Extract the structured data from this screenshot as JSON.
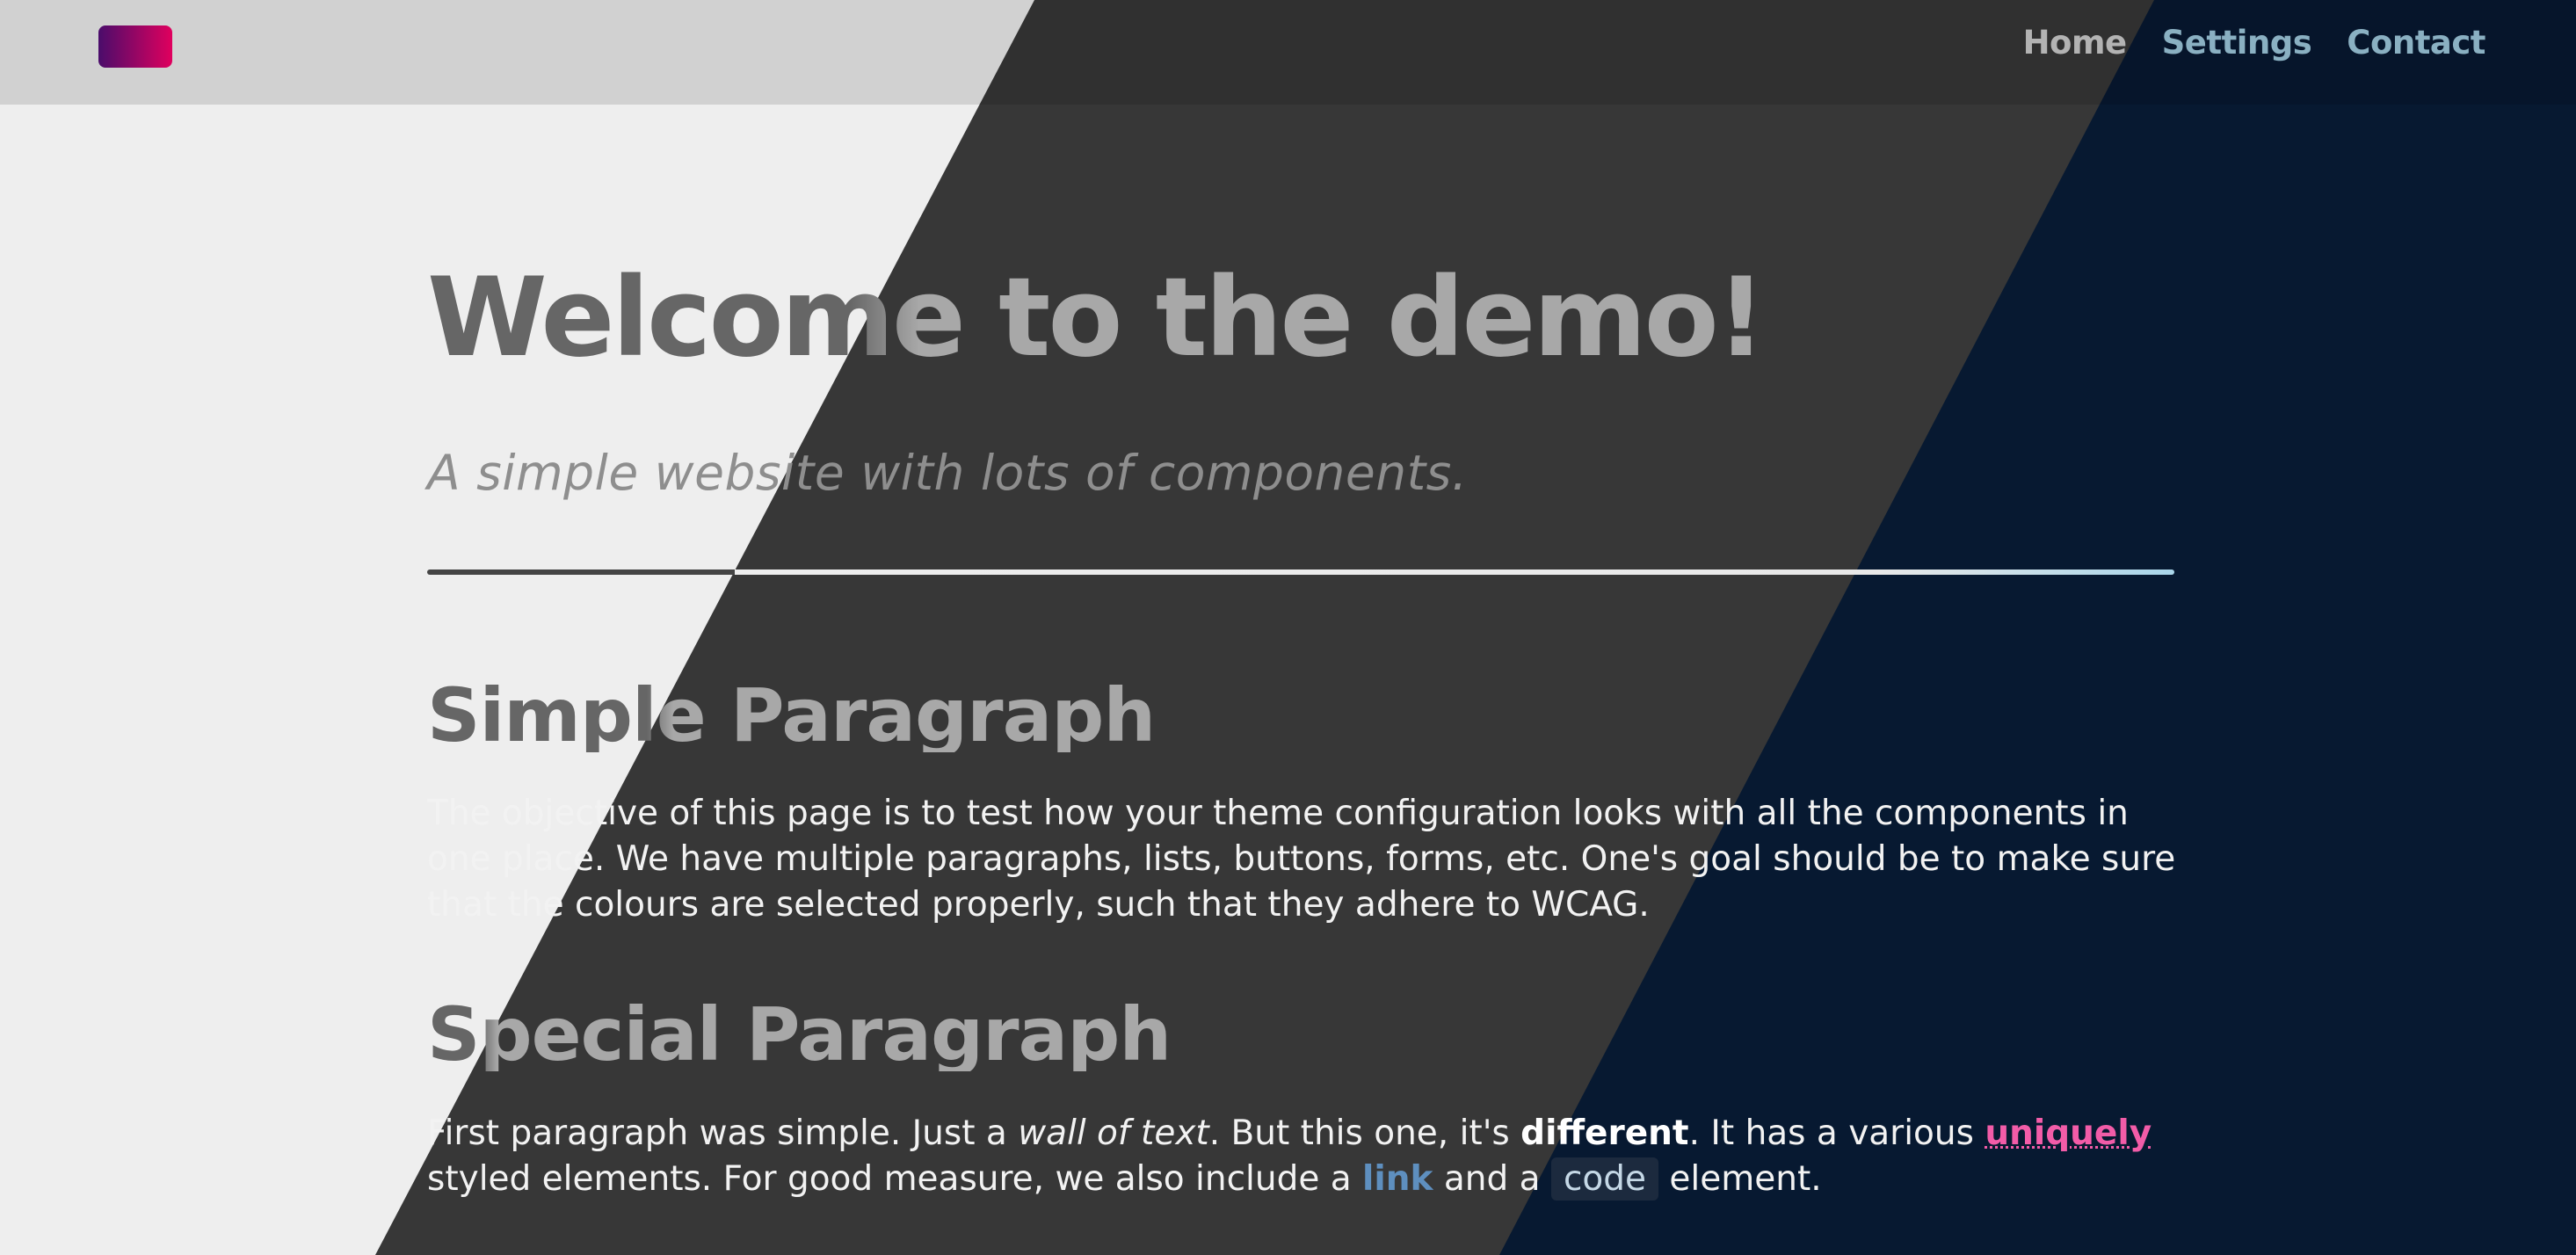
{
  "nav": {
    "items": [
      {
        "label": "Home"
      },
      {
        "label": "Settings"
      },
      {
        "label": "Contact"
      }
    ]
  },
  "hero": {
    "title": "Welcome to the demo!",
    "subtitle": "A simple website with lots of components."
  },
  "simple": {
    "title": "Simple Paragraph",
    "text": "The objective of this page is to test how your theme configuration looks with all the components in one place. We have multiple paragraphs, lists, buttons, forms, etc. One's goal should be to make sure that the colours are selected properly, such that they adhere to WCAG."
  },
  "special": {
    "title": "Special Paragraph",
    "t1": "First paragraph was simple. Just a ",
    "em": "wall of text",
    "t2": ". But this one, it's ",
    "strong": "different",
    "t3": ". It has a various ",
    "unique": "uniquely",
    "t4": " styled elements. For good measure, we also include a ",
    "link": "link",
    "t5": " and a ",
    "code": "code",
    "t6": " element."
  },
  "colors": {
    "background_light": "#eeeeee",
    "background_dark": "#373737",
    "background_navy": "#071931",
    "accent_pink": "#f25ca8",
    "link_blue": "#5e8fbf",
    "logo_gradient_start": "#4a0c6b",
    "logo_gradient_end": "#e0005e"
  }
}
